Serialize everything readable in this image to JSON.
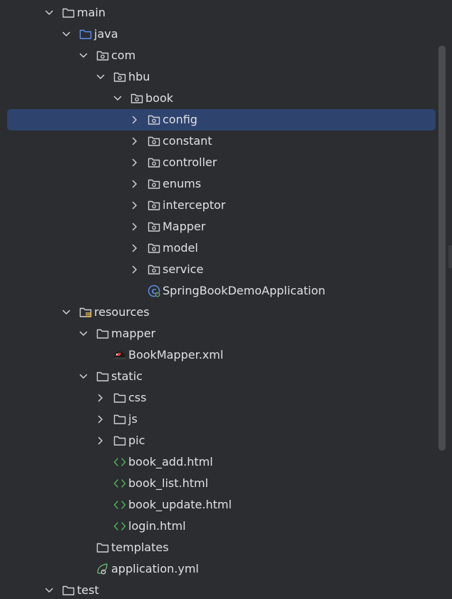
{
  "colors": {
    "background": "#2b2d30",
    "selection": "#2e436e",
    "text": "#dfe1e5",
    "muted_icon": "#cfd1d5",
    "source_folder_icon": "#5f8ff0",
    "html_icon": "#4fad5b",
    "spring_icon": "#6aab73",
    "scrollbar": "#4a4c50"
  },
  "tree": {
    "rows": [
      {
        "label": "main",
        "chevron": "down",
        "icon": "folder-icon",
        "selected": false
      },
      {
        "label": "java",
        "chevron": "down",
        "icon": "source-folder-icon",
        "selected": false
      },
      {
        "label": "com",
        "chevron": "down",
        "icon": "package-icon",
        "selected": false
      },
      {
        "label": "hbu",
        "chevron": "down",
        "icon": "package-icon",
        "selected": false
      },
      {
        "label": "book",
        "chevron": "down",
        "icon": "package-icon",
        "selected": false
      },
      {
        "label": "config",
        "chevron": "right",
        "icon": "package-icon",
        "selected": true
      },
      {
        "label": "constant",
        "chevron": "right",
        "icon": "package-icon",
        "selected": false
      },
      {
        "label": "controller",
        "chevron": "right",
        "icon": "package-icon",
        "selected": false
      },
      {
        "label": "enums",
        "chevron": "right",
        "icon": "package-icon",
        "selected": false
      },
      {
        "label": "interceptor",
        "chevron": "right",
        "icon": "package-icon",
        "selected": false
      },
      {
        "label": "Mapper",
        "chevron": "right",
        "icon": "package-icon",
        "selected": false
      },
      {
        "label": "model",
        "chevron": "right",
        "icon": "package-icon",
        "selected": false
      },
      {
        "label": "service",
        "chevron": "right",
        "icon": "package-icon",
        "selected": false
      },
      {
        "label": "SpringBookDemoApplication",
        "chevron": "none",
        "icon": "spring-boot-class-icon",
        "selected": false
      },
      {
        "label": "resources",
        "chevron": "down",
        "icon": "resources-folder-icon",
        "selected": false
      },
      {
        "label": "mapper",
        "chevron": "down",
        "icon": "folder-icon",
        "selected": false
      },
      {
        "label": "BookMapper.xml",
        "chevron": "none",
        "icon": "mybatis-xml-icon",
        "selected": false
      },
      {
        "label": "static",
        "chevron": "down",
        "icon": "folder-icon",
        "selected": false
      },
      {
        "label": "css",
        "chevron": "right",
        "icon": "folder-icon",
        "selected": false
      },
      {
        "label": "js",
        "chevron": "right",
        "icon": "folder-icon",
        "selected": false
      },
      {
        "label": "pic",
        "chevron": "right",
        "icon": "folder-icon",
        "selected": false
      },
      {
        "label": "book_add.html",
        "chevron": "none",
        "icon": "html-file-icon",
        "selected": false
      },
      {
        "label": "book_list.html",
        "chevron": "none",
        "icon": "html-file-icon",
        "selected": false
      },
      {
        "label": "book_update.html",
        "chevron": "none",
        "icon": "html-file-icon",
        "selected": false
      },
      {
        "label": "login.html",
        "chevron": "none",
        "icon": "html-file-icon",
        "selected": false
      },
      {
        "label": "templates",
        "chevron": "none",
        "icon": "folder-icon",
        "selected": false
      },
      {
        "label": "application.yml",
        "chevron": "none",
        "icon": "spring-config-icon",
        "selected": false
      },
      {
        "label": "test",
        "chevron": "down",
        "icon": "folder-icon",
        "selected": false
      }
    ]
  }
}
